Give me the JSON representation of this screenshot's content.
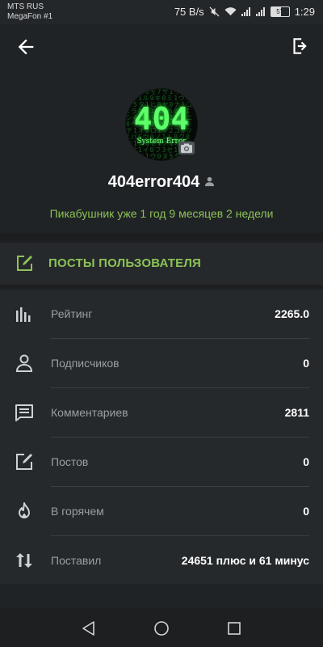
{
  "statusbar": {
    "carrier1": "MTS RUS",
    "carrier2": "MegaFon #1",
    "speed": "75 B/s",
    "battery": "57",
    "time": "1:29"
  },
  "avatar": {
    "big_text": "404",
    "small_text": "System Error"
  },
  "profile": {
    "username": "404error404",
    "tenure": "Пикабушник уже 1 год 9 месяцев 2 недели"
  },
  "posts_link": {
    "label": "ПОСТЫ ПОЛЬЗОВАТЕЛЯ",
    "icon": "edit-icon"
  },
  "stats": [
    {
      "label": "Рейтинг",
      "value": "2265.0",
      "icon": "bar-chart-icon"
    },
    {
      "label": "Подписчиков",
      "value": "0",
      "icon": "person-icon"
    },
    {
      "label": "Комментариев",
      "value": "2811",
      "icon": "comment-icon"
    },
    {
      "label": "Постов",
      "value": "0",
      "icon": "edit-icon"
    },
    {
      "label": "В горячем",
      "value": "0",
      "icon": "flame-icon"
    },
    {
      "label": "Поставил",
      "value": "24651 плюс и 61 минус",
      "icon": "swap-vertical-icon"
    }
  ],
  "colors": {
    "accent_green": "#8cc256",
    "background": "#202326",
    "card": "#26292c"
  }
}
